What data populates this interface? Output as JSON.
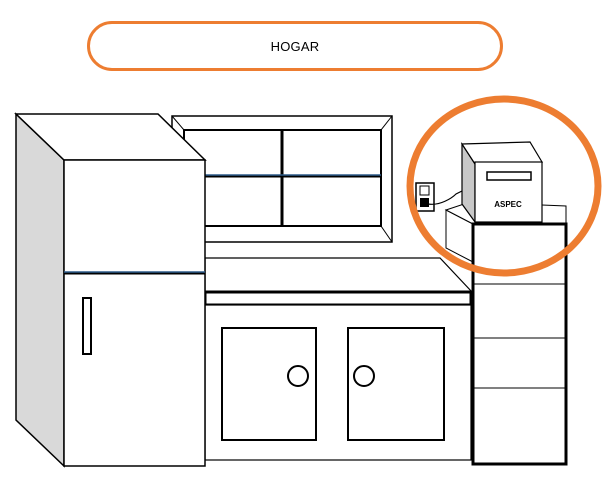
{
  "title": "HOGAR",
  "device": {
    "label": "ASPEC",
    "icon": "voltage-regulator-icon"
  },
  "scene_items": [
    "refrigerator-icon",
    "window-icon",
    "kitchen-counter-icon",
    "sink-cabinet-icon",
    "drawer-cabinet-icon",
    "wall-outlet-icon",
    "power-cable-icon"
  ],
  "colors": {
    "highlight": "#ed7d31",
    "accent_line": "#2e5c8a",
    "outline": "#000000",
    "shadow": "#d9d9d9"
  }
}
